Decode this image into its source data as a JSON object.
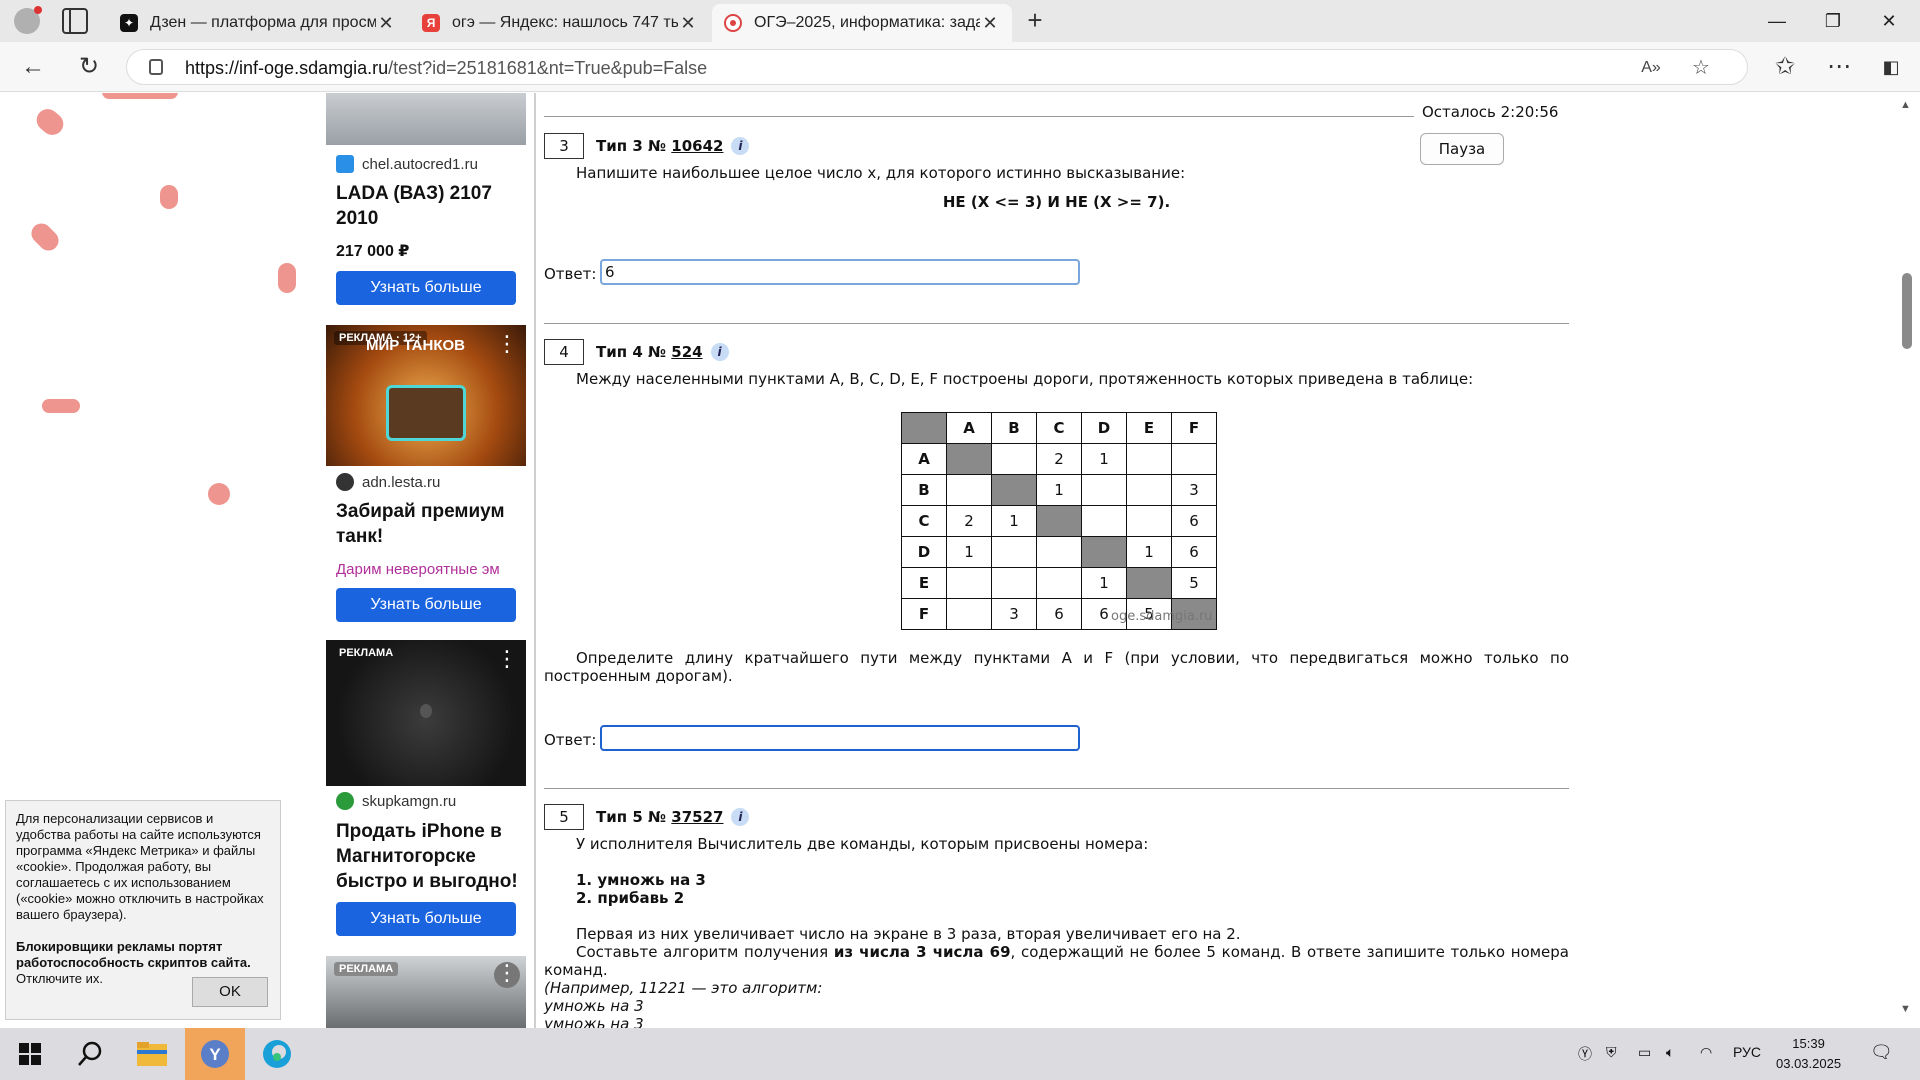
{
  "browser": {
    "tabs": [
      {
        "title": "Дзен — платформа для просмот",
        "active": false
      },
      {
        "title": "огэ — Яндекс: нашлось 747 тыс.",
        "active": false
      },
      {
        "title": "ОГЭ–2025, информатика: задани",
        "active": true
      }
    ],
    "url_host": "https://inf-oge.sdamgia.ru",
    "url_path": "/test?id=25181681&nt=True&pub=False"
  },
  "ads": [
    {
      "domain": "chel.autocred1.ru",
      "headline": "LADA (ВАЗ) 2107 2010",
      "price": "217 000 ₽",
      "button": "Узнать больше"
    },
    {
      "badge": "РЕКЛАМА · 12+",
      "image_text": "МИР ТАНКОВ",
      "domain": "adn.lesta.ru",
      "headline": "Забирай премиум танк!",
      "subtitle": "Дарим невероятные эм",
      "button": "Узнать больше"
    },
    {
      "badge": "РЕКЛАМА",
      "domain": "skupkamgn.ru",
      "headline": "Продать iPhone в Магнитогорске быстро и выгодно!",
      "button": "Узнать больше"
    },
    {
      "badge": "РЕКЛАМА"
    }
  ],
  "cookie": {
    "text": "Для персонализации сервисов и удобства работы на сайте исполь­зуются программа «Яндекс Метрика» и файлы «cookie». Продолжая работу, вы соглашаетесь с их использовани­ем («cookie» можно отключить в на­стройках вашего браузера).",
    "warning_bold": "Блокировщики рекламы портят работоспособность скриптов сайта.",
    "warning_rest": " Отключите их.",
    "ok": "OK"
  },
  "test": {
    "timer": "Осталось 2:20:56",
    "pause": "Пауза",
    "answer_label": "Ответ:",
    "q3": {
      "num": "3",
      "type": "Тип 3 №",
      "id": "10642",
      "text": "Напишите наибольшее целое число x, для которого истинно высказывание:",
      "formula": "НЕ (X <= 3) И НЕ (X >= 7).",
      "answer": "6"
    },
    "q4": {
      "num": "4",
      "type": "Тип 4 №",
      "id": "524",
      "text": "Между населенными пунктами A, B, C, D, E, F построены дороги, протяженность которых приведена в таблице:",
      "headers": [
        "A",
        "B",
        "C",
        "D",
        "E",
        "F"
      ],
      "rows": [
        {
          "name": "A",
          "cells": [
            "",
            "",
            "2",
            "1",
            "",
            ""
          ]
        },
        {
          "name": "B",
          "cells": [
            "",
            "",
            "1",
            "",
            "",
            "3"
          ]
        },
        {
          "name": "C",
          "cells": [
            "2",
            "1",
            "",
            "",
            "",
            "6"
          ]
        },
        {
          "name": "D",
          "cells": [
            "1",
            "",
            "",
            "",
            "1",
            "6"
          ]
        },
        {
          "name": "E",
          "cells": [
            "",
            "",
            "",
            "1",
            "",
            "5"
          ]
        },
        {
          "name": "F",
          "cells": [
            "",
            "3",
            "6",
            "6",
            "5",
            ""
          ]
        }
      ],
      "watermark": "oge.sdamgia.ru",
      "question": "Определите длину кратчайшего пути между пунктами A и F (при условии, что передвигаться можно только по построенным дорогам).",
      "answer": ""
    },
    "q5": {
      "num": "5",
      "type": "Тип 5 №",
      "id": "37527",
      "intro": "У исполнителя Вычислитель две команды, которым присвоены номера:",
      "cmd1": "1. умножь на 3",
      "cmd2": "2. прибавь 2",
      "p1": "Первая из них увеличивает число на экране в 3 раза, вторая увеличивает его на 2.",
      "p2a": "Составьте алгоритм получения ",
      "p2b": "из числа 3 числа 69",
      "p2c": ", содержащий не более 5 команд. В ответе запишите только номера ко­манд.",
      "ex": "(Например, 11221 — это алгоритм:",
      "ex1": "умножь на 3",
      "ex2": "умножь на 3"
    }
  },
  "taskbar": {
    "lang": "РУС",
    "time": "15:39",
    "date": "03.03.2025"
  }
}
